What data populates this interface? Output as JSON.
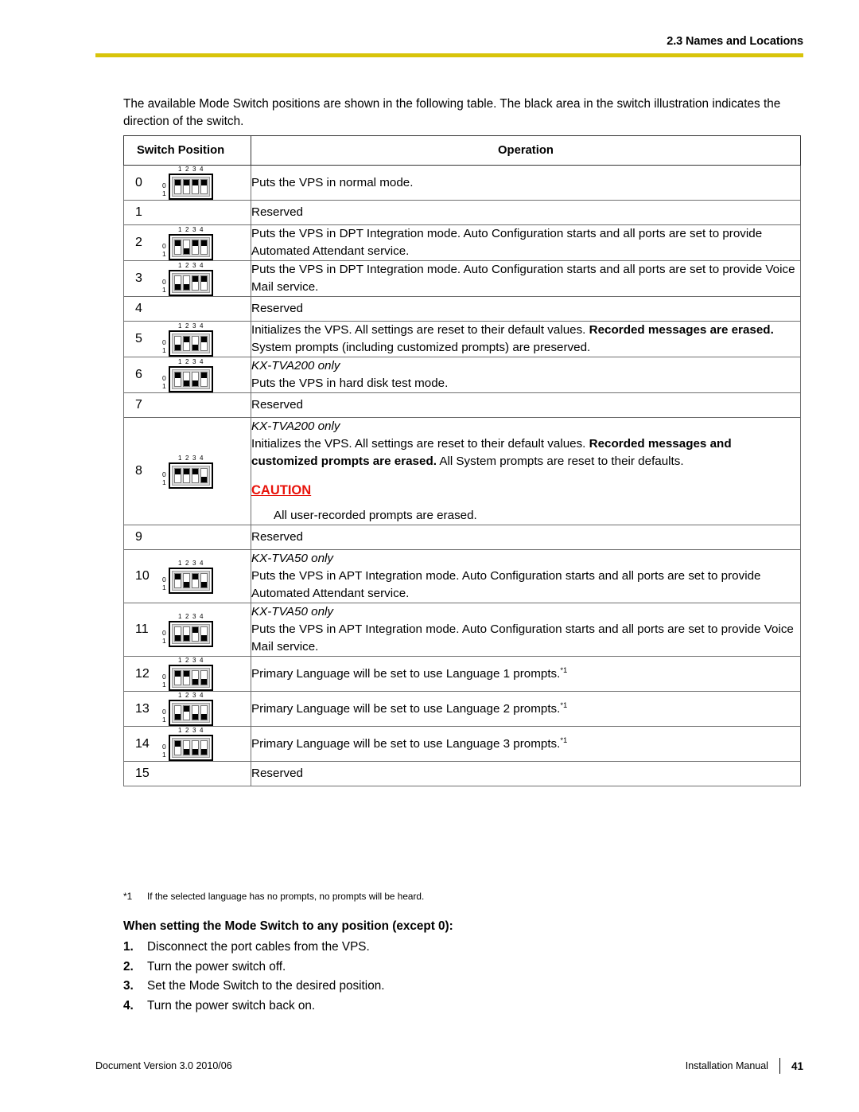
{
  "header": {
    "section_title": "2.3 Names and Locations",
    "rule_color": "#d8c40a"
  },
  "intro": "The available Mode Switch positions are shown in the following table. The black area in the switch illustration indicates the direction of the switch.",
  "table": {
    "columns": [
      "Switch Position",
      "Operation"
    ],
    "switch_labels": {
      "top": [
        "1",
        "2",
        "3",
        "4"
      ],
      "left_top": "0",
      "left_bottom": "1"
    },
    "rows": [
      {
        "position": "0",
        "has_switch": true,
        "switches": [
          "up",
          "up",
          "up",
          "up"
        ],
        "lines": [
          {
            "text": "Puts the VPS in normal mode."
          }
        ]
      },
      {
        "position": "1",
        "has_switch": false,
        "switches": [],
        "lines": [
          {
            "text": "Reserved"
          }
        ]
      },
      {
        "position": "2",
        "has_switch": true,
        "switches": [
          "up",
          "down",
          "up",
          "up"
        ],
        "lines": [
          {
            "text": "Puts the VPS in DPT Integration mode. Auto Configuration starts and all ports are set to provide Automated Attendant service."
          }
        ]
      },
      {
        "position": "3",
        "has_switch": true,
        "switches": [
          "down",
          "down",
          "up",
          "up"
        ],
        "lines": [
          {
            "text": "Puts the VPS in DPT Integration mode. Auto Configuration starts and all ports are set to provide Voice Mail service."
          }
        ]
      },
      {
        "position": "4",
        "has_switch": false,
        "switches": [],
        "lines": [
          {
            "text": "Reserved"
          }
        ]
      },
      {
        "position": "5",
        "has_switch": true,
        "switches": [
          "down",
          "up",
          "down",
          "up"
        ],
        "lines": [
          {
            "text": "Initializes the VPS. All settings are reset to their default values. "
          },
          {
            "text": "Recorded messages are erased.",
            "bold": true
          },
          {
            "text": " System prompts (including customized prompts) are preserved."
          }
        ]
      },
      {
        "position": "6",
        "has_switch": true,
        "switches": [
          "up",
          "down",
          "down",
          "up"
        ],
        "lines": [
          {
            "text": "KX-TVA200 only",
            "italic": true,
            "block": true
          },
          {
            "text": "Puts the VPS in hard disk test mode.",
            "block": true
          }
        ]
      },
      {
        "position": "7",
        "has_switch": false,
        "switches": [],
        "lines": [
          {
            "text": "Reserved"
          }
        ]
      },
      {
        "position": "8",
        "has_switch": true,
        "switches": [
          "up",
          "up",
          "up",
          "down"
        ],
        "lines": [
          {
            "text": "KX-TVA200 only",
            "italic": true,
            "block": true
          },
          {
            "text": "Initializes the VPS. All settings are reset to their default values. "
          },
          {
            "text": "Recorded messages and customized prompts are erased.",
            "bold": true
          },
          {
            "text": " All System prompts are reset to their defaults."
          }
        ],
        "caution": {
          "label": "CAUTION",
          "color": "#e8140c",
          "text": "All user-recorded prompts are erased."
        }
      },
      {
        "position": "9",
        "has_switch": false,
        "switches": [],
        "lines": [
          {
            "text": "Reserved"
          }
        ]
      },
      {
        "position": "10",
        "has_switch": true,
        "switches": [
          "up",
          "down",
          "up",
          "down"
        ],
        "lines": [
          {
            "text": "KX-TVA50 only",
            "italic": true,
            "block": true
          },
          {
            "text": "Puts the VPS in APT Integration mode. Auto Configuration starts and all ports are set to provide Automated Attendant service.",
            "block": true
          }
        ]
      },
      {
        "position": "11",
        "has_switch": true,
        "switches": [
          "down",
          "down",
          "up",
          "down"
        ],
        "lines": [
          {
            "text": "KX-TVA50 only",
            "italic": true,
            "block": true
          },
          {
            "text": "Puts the VPS in APT Integration mode. Auto Configuration starts and all ports are set to provide Voice Mail service.",
            "block": true
          }
        ]
      },
      {
        "position": "12",
        "has_switch": true,
        "switches": [
          "up",
          "up",
          "down",
          "down"
        ],
        "lines": [
          {
            "text": "Primary Language will be set to use Language 1 prompts.",
            "footnote": "*1"
          }
        ]
      },
      {
        "position": "13",
        "has_switch": true,
        "switches": [
          "down",
          "up",
          "down",
          "down"
        ],
        "lines": [
          {
            "text": "Primary Language will be set to use Language 2 prompts.",
            "footnote": "*1"
          }
        ]
      },
      {
        "position": "14",
        "has_switch": true,
        "switches": [
          "up",
          "down",
          "down",
          "down"
        ],
        "lines": [
          {
            "text": "Primary Language will be set to use Language 3 prompts.",
            "footnote": "*1"
          }
        ]
      },
      {
        "position": "15",
        "has_switch": false,
        "switches": [],
        "lines": [
          {
            "text": "Reserved"
          }
        ]
      }
    ]
  },
  "footnote": {
    "mark": "*1",
    "text": "If the selected language has no prompts, no prompts will be heard."
  },
  "steps_title": "When setting the Mode Switch to any position (except 0):",
  "steps": [
    {
      "num": "1.",
      "text": "Disconnect the port cables from the VPS."
    },
    {
      "num": "2.",
      "text": "Turn the power switch off."
    },
    {
      "num": "3.",
      "text": "Set the Mode Switch to the desired position."
    },
    {
      "num": "4.",
      "text": "Turn the power switch back on."
    }
  ],
  "footer": {
    "left": "Document Version  3.0  2010/06",
    "manual": "Installation Manual",
    "page": "41"
  }
}
